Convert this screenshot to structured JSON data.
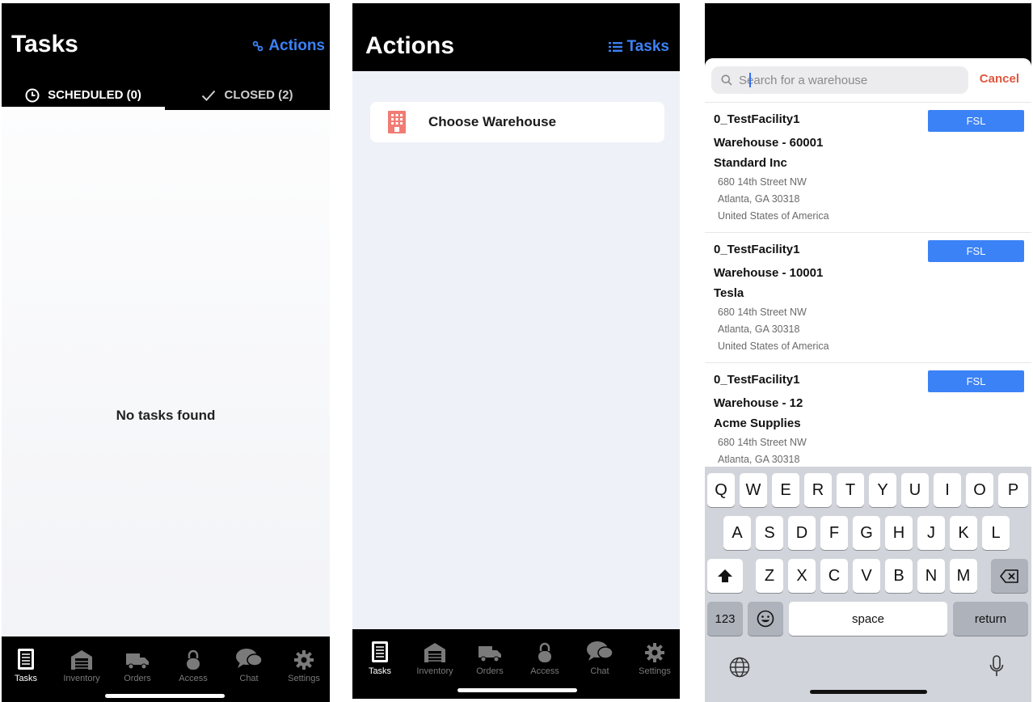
{
  "screen1": {
    "title": "Tasks",
    "header_link": "Actions",
    "segments": [
      {
        "label": "SCHEDULED (0)",
        "icon": "clock-icon",
        "selected": true
      },
      {
        "label": "CLOSED (2)",
        "icon": "checkmark-icon",
        "selected": false
      }
    ],
    "empty_message": "No tasks found"
  },
  "screen2": {
    "title": "Actions",
    "header_link": "Tasks",
    "card_label": "Choose Warehouse",
    "card_icon": "building-icon"
  },
  "tabbar": {
    "items": [
      {
        "label": "Tasks",
        "icon": "tasks-icon"
      },
      {
        "label": "Inventory",
        "icon": "warehouse-icon"
      },
      {
        "label": "Orders",
        "icon": "truck-icon"
      },
      {
        "label": "Access",
        "icon": "lock-icon"
      },
      {
        "label": "Chat",
        "icon": "chat-icon"
      },
      {
        "label": "Settings",
        "icon": "gear-icon"
      }
    ],
    "active_color": "#ffffff",
    "inactive_color": "#7a7a7a"
  },
  "screen3": {
    "search_placeholder": "Search for a warehouse",
    "cancel_label": "Cancel",
    "warehouses": [
      {
        "facility": "0_TestFacility1",
        "name": "Warehouse -  60001",
        "company": "Standard Inc",
        "address": [
          "680 14th Street NW",
          "Atlanta, GA 30318",
          "United States of America"
        ],
        "button": "FSL"
      },
      {
        "facility": "0_TestFacility1",
        "name": "Warehouse -  10001",
        "company": "Tesla",
        "address": [
          "680 14th Street NW",
          "Atlanta, GA 30318",
          "United States of America"
        ],
        "button": "FSL"
      },
      {
        "facility": "0_TestFacility1",
        "name": "Warehouse -  12",
        "company": "Acme Supplies",
        "address": [
          "680 14th Street NW",
          "Atlanta, GA 30318"
        ],
        "button": "FSL"
      }
    ],
    "keyboard": {
      "row1": [
        "Q",
        "W",
        "E",
        "R",
        "T",
        "Y",
        "U",
        "I",
        "O",
        "P"
      ],
      "row2": [
        "A",
        "S",
        "D",
        "F",
        "G",
        "H",
        "J",
        "K",
        "L"
      ],
      "row3": [
        "Z",
        "X",
        "C",
        "V",
        "B",
        "N",
        "M"
      ],
      "numbers": "123",
      "space": "space",
      "return": "return"
    }
  },
  "colors": {
    "accent": "#3b82f6",
    "header_bg": "#000000",
    "cancel": "#e0553e",
    "warehouse_icon": "#f07c74"
  }
}
